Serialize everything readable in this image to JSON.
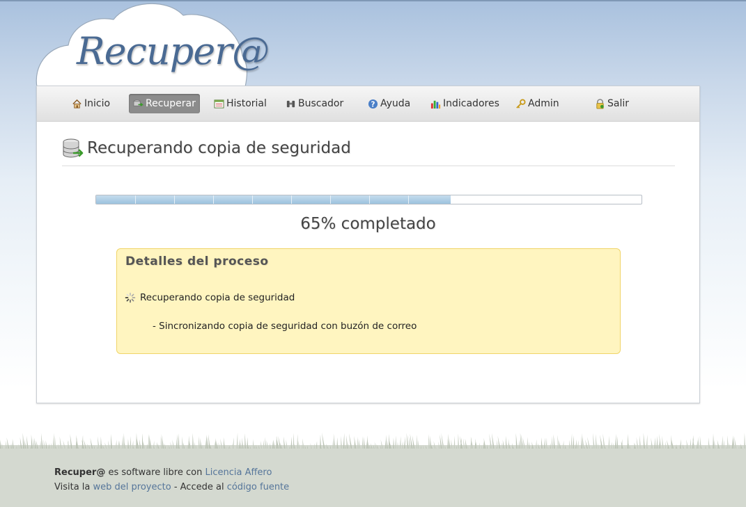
{
  "app": {
    "logo": "Recuper@"
  },
  "nav": {
    "items": [
      {
        "label": "Inicio",
        "icon": "home-icon"
      },
      {
        "label": "Recuperar",
        "icon": "recover-icon",
        "active": true
      },
      {
        "label": "Historial",
        "icon": "history-icon"
      },
      {
        "label": "Buscador",
        "icon": "binoculars-icon"
      },
      {
        "label": "Ayuda",
        "icon": "help-icon"
      },
      {
        "label": "Indicadores",
        "icon": "chart-icon"
      },
      {
        "label": "Admin",
        "icon": "key-icon"
      },
      {
        "label": "Salir",
        "icon": "lock-icon"
      }
    ]
  },
  "page": {
    "title": "Recuperando copia de seguridad",
    "icon": "database-restore-icon"
  },
  "progress": {
    "percent": 65,
    "label": "65% completado",
    "segments": 9
  },
  "details": {
    "title": "Detalles del proceso",
    "step": "Recuperando copia de seguridad",
    "substep": "- Sincronizando copia de seguridad con buzón de correo"
  },
  "footer": {
    "brand": "Recuper@",
    "line1_text": " es software libre con ",
    "license_link": "Licencia Affero",
    "line2_prefix": "Visita la ",
    "project_link": "web del proyecto",
    "line2_middle": " - Accede al ",
    "source_link": "código fuente"
  },
  "colors": {
    "accent": "#4a6a93",
    "progress": "#9cc3de",
    "details_bg": "#fff5c0",
    "link": "#55759a"
  }
}
